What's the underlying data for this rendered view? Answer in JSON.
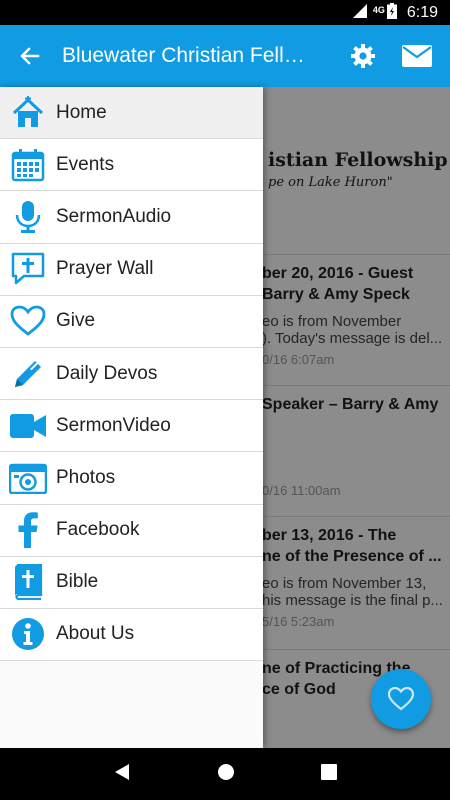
{
  "status": {
    "network": "4G",
    "time": "6:19"
  },
  "app_bar": {
    "title": "Bluewater Christian Fellowship",
    "back_icon": "arrow-back-icon",
    "settings_icon": "gear-icon",
    "mail_icon": "mail-icon"
  },
  "background": {
    "banner_line1": "istian Fellowship",
    "banner_line2": "pe on Lake Huron\"",
    "posts": [
      {
        "title1": "ber 20, 2016 - Guest",
        "title2": "Barry & Amy Speck",
        "body1": "eo is from November",
        "body2": "). Today's message is del...",
        "date": "0/16 6:07am"
      },
      {
        "title1": "Speaker – Barry & Amy",
        "title2": "",
        "body1": "",
        "body2": "",
        "date": "0/16 11:00am"
      },
      {
        "title1": "ber 13, 2016 - The",
        "title2": "ne of the Presence of ...",
        "body1": "eo is from November 13,",
        "body2": "his message is the final p...",
        "date": "5/16 5:23am"
      },
      {
        "title1": "ne of Practicing the",
        "title2": "ce of God",
        "body1": "",
        "body2": "",
        "date": ""
      }
    ]
  },
  "drawer": {
    "items": [
      {
        "label": "Home",
        "icon": "home-icon"
      },
      {
        "label": "Events",
        "icon": "calendar-icon"
      },
      {
        "label": "SermonAudio",
        "icon": "microphone-icon"
      },
      {
        "label": "Prayer Wall",
        "icon": "prayer-bubble-icon"
      },
      {
        "label": "Give",
        "icon": "heart-icon"
      },
      {
        "label": "Daily Devos",
        "icon": "pencil-icon"
      },
      {
        "label": "SermonVideo",
        "icon": "video-camera-icon"
      },
      {
        "label": "Photos",
        "icon": "camera-icon"
      },
      {
        "label": "Facebook",
        "icon": "facebook-icon"
      },
      {
        "label": "Bible",
        "icon": "bible-icon"
      },
      {
        "label": "About Us",
        "icon": "info-icon"
      }
    ]
  },
  "colors": {
    "accent": "#109be2",
    "status_bar": "#000000",
    "drawer_bg": "#fafafa"
  }
}
